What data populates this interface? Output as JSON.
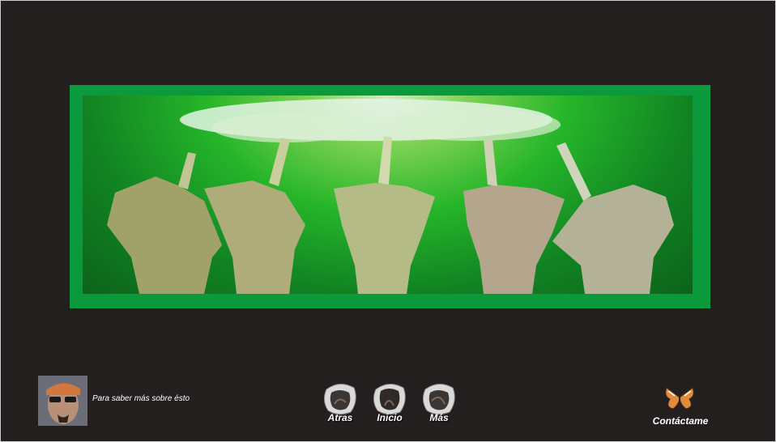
{
  "about": {
    "text": "Para saber más sobre ésto"
  },
  "nav": {
    "items": [
      {
        "label": "Atras"
      },
      {
        "label": "Inicio"
      },
      {
        "label": "Más"
      }
    ]
  },
  "contact": {
    "label": "Contáctame"
  },
  "colors": {
    "page_background": "#231f1e",
    "banner_frame": "#0a9a3d",
    "banner_glow": "#e9f7d6",
    "text": "#ffffff"
  },
  "icons": {
    "banner": "unicorn-sculptures-image",
    "avatar": "user-avatar-photo",
    "nav_button": "glass-stone-icon",
    "contact": "butterfly-icon"
  }
}
